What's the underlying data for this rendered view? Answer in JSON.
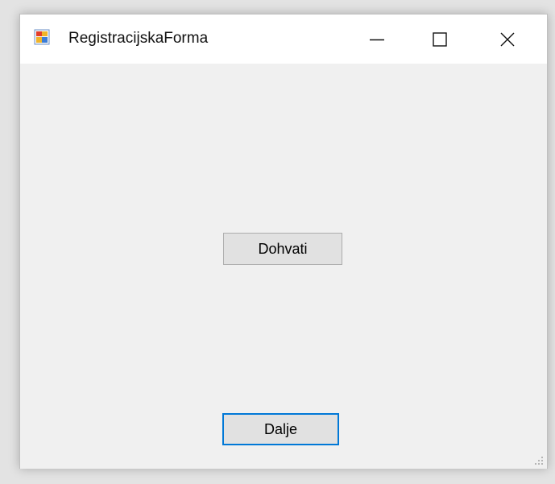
{
  "window": {
    "title": "RegistracijskaForma",
    "icon": "winforms-app-icon",
    "controls": {
      "minimize_icon": "minimize-icon",
      "maximize_icon": "maximize-icon",
      "close_icon": "close-icon"
    }
  },
  "form": {
    "dohvati_label": "Dohvati",
    "dalje_label": "Dalje"
  },
  "colors": {
    "focus_border": "#0078d7",
    "button_face": "#e1e1e1",
    "form_background": "#f0f0f0"
  }
}
